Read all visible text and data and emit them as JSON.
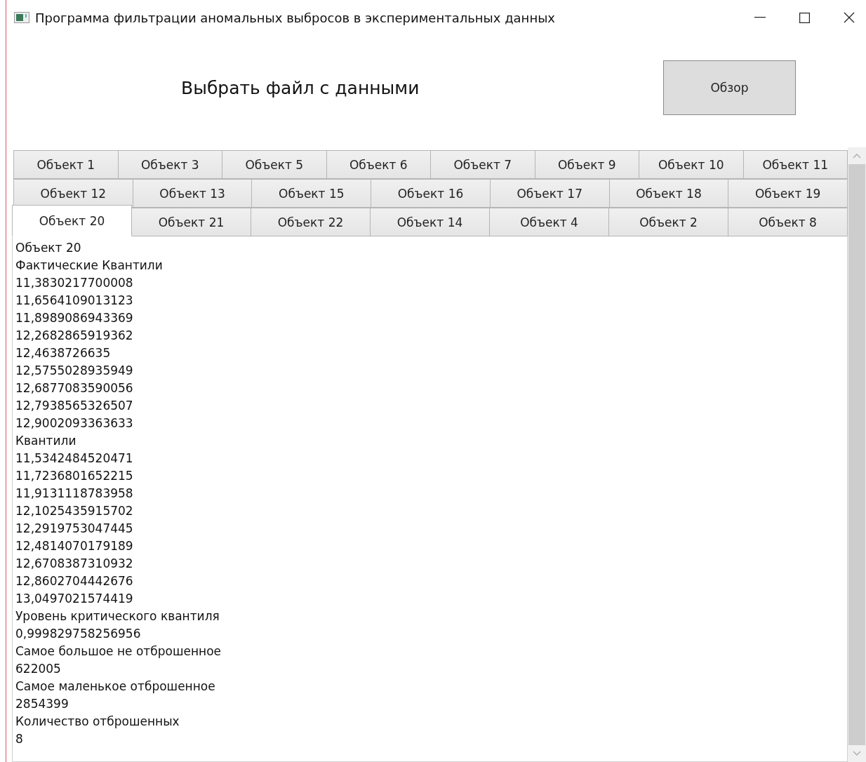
{
  "window": {
    "title": "Программа фильтрации аномальных выбросов в экспериментальных данных"
  },
  "file_label": "Выбрать файл с данными",
  "browse_button": "Обзор",
  "tab_rows": [
    [
      {
        "label": "Объект 1",
        "selected": false
      },
      {
        "label": "Объект 3",
        "selected": false
      },
      {
        "label": "Объект 5",
        "selected": false
      },
      {
        "label": "Объект 6",
        "selected": false
      },
      {
        "label": "Объект 7",
        "selected": false
      },
      {
        "label": "Объект 9",
        "selected": false
      },
      {
        "label": "Объект 10",
        "selected": false
      },
      {
        "label": "Объект 11",
        "selected": false
      }
    ],
    [
      {
        "label": "Объект 12",
        "selected": false
      },
      {
        "label": "Объект 13",
        "selected": false
      },
      {
        "label": "Объект 15",
        "selected": false
      },
      {
        "label": "Объект 16",
        "selected": false
      },
      {
        "label": "Объект 17",
        "selected": false
      },
      {
        "label": "Объект 18",
        "selected": false
      },
      {
        "label": "Объект 19",
        "selected": false
      }
    ],
    [
      {
        "label": "Объект 20",
        "selected": true
      },
      {
        "label": "Объект 21",
        "selected": false
      },
      {
        "label": "Объект 22",
        "selected": false
      },
      {
        "label": "Объект 14",
        "selected": false
      },
      {
        "label": "Объект 4",
        "selected": false
      },
      {
        "label": "Объект 2",
        "selected": false
      },
      {
        "label": "Объект 8",
        "selected": false
      }
    ]
  ],
  "output_lines": [
    "Объект 20",
    "Фактические Квантили",
    "11,3830217700008",
    "11,6564109013123",
    "11,8989086943369",
    "12,2682865919362",
    "12,4638726635",
    "12,5755028935949",
    "12,6877083590056",
    "12,7938565326507",
    "12,9002093363633",
    "Квантили",
    "11,5342484520471",
    "11,7236801652215",
    "11,9131118783958",
    "12,1025435915702",
    "12,2919753047445",
    "12,4814070179189",
    "12,6708387310932",
    "12,8602704442676",
    "13,0497021574419",
    "Уровень критического квантиля",
    "0,999829758256956",
    "Самое большое не отброшенное",
    "622005",
    "Самое маленькое отброшенное",
    "2854399",
    "Количество отброшенных",
    "8"
  ]
}
